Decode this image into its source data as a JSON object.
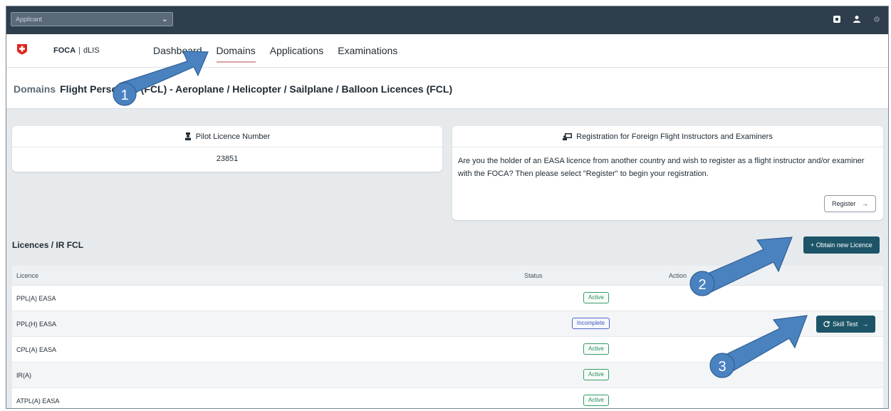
{
  "topbar": {
    "role_select": "Applicant"
  },
  "navbar": {
    "brand_main": "FOCA",
    "brand_sep": "|",
    "brand_sub": "dLIS",
    "tabs": [
      {
        "label": "Dashboard"
      },
      {
        "label": "Domains"
      },
      {
        "label": "Applications"
      },
      {
        "label": "Examinations"
      }
    ]
  },
  "title": {
    "crumb": "Domains",
    "heading": "Flight Personnel (FCL) - Aeroplane / Helicopter / Sailplane / Balloon Licences (FCL)"
  },
  "pilot_card": {
    "title": "Pilot Licence Number",
    "number": "23851"
  },
  "registration_card": {
    "title": "Registration for Foreign Flight Instructors and Examiners",
    "text": "Are you the holder of an EASA licence from another country and wish to register as a flight instructor and/or examiner with the FOCA? Then please select \"Register\" to begin your registration.",
    "button": "Register",
    "button_arrow": "→"
  },
  "licences": {
    "title": "Licences / IR FCL",
    "new_button": "+ Obtain new Licence",
    "columns": [
      "Licence",
      "Status",
      "Action"
    ],
    "rows": [
      {
        "licence": "PPL(A) EASA",
        "status": "Active"
      },
      {
        "licence": "PPL(H) EASA",
        "status": "Incomplete",
        "action": "Skill Test"
      },
      {
        "licence": "CPL(A) EASA",
        "status": "Active"
      },
      {
        "licence": "IR(A)",
        "status": "Active"
      },
      {
        "licence": "ATPL(A) EASA",
        "status": "Active"
      }
    ],
    "action_arrow": "→"
  },
  "annotations": {
    "labels": [
      "1",
      "2",
      "3"
    ],
    "color": "#4a82c0"
  },
  "colors": {
    "topbar": "#2f3e4c",
    "primary": "#1d5468",
    "active_badge": "#3a9b6a",
    "incomplete_badge": "#4a68c9",
    "swiss_red": "#e2231a"
  }
}
